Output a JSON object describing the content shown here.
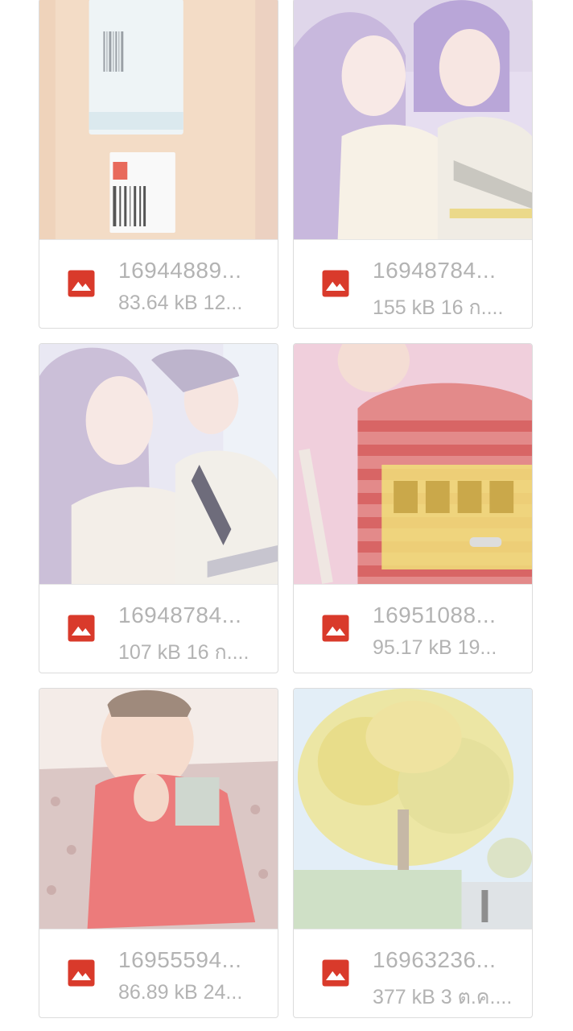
{
  "files": [
    {
      "name": "16944889...",
      "meta": "83.64 kB 12...",
      "thumb_icon": "envelope-package-photo"
    },
    {
      "name": "16948784...",
      "meta": "155 kB 16 ก....",
      "thumb_icon": "two-women-selfie-photo"
    },
    {
      "name": "16948784...",
      "meta": "107 kB 16 ก....",
      "thumb_icon": "two-women-selfie-photo"
    },
    {
      "name": "16951088...",
      "meta": "95.17 kB 19...",
      "thumb_icon": "person-striped-shirt-photo"
    },
    {
      "name": "16955594...",
      "meta": "86.89 kB 24...",
      "thumb_icon": "child-red-shirt-photo"
    },
    {
      "name": "16963236...",
      "meta": "377 kB 3 ต.ค....",
      "thumb_icon": "autumn-tree-photo"
    }
  ],
  "colors": {
    "image_icon": "#d93a2b",
    "text": "#b3b3b3",
    "card_border": "#dcdcdc"
  }
}
